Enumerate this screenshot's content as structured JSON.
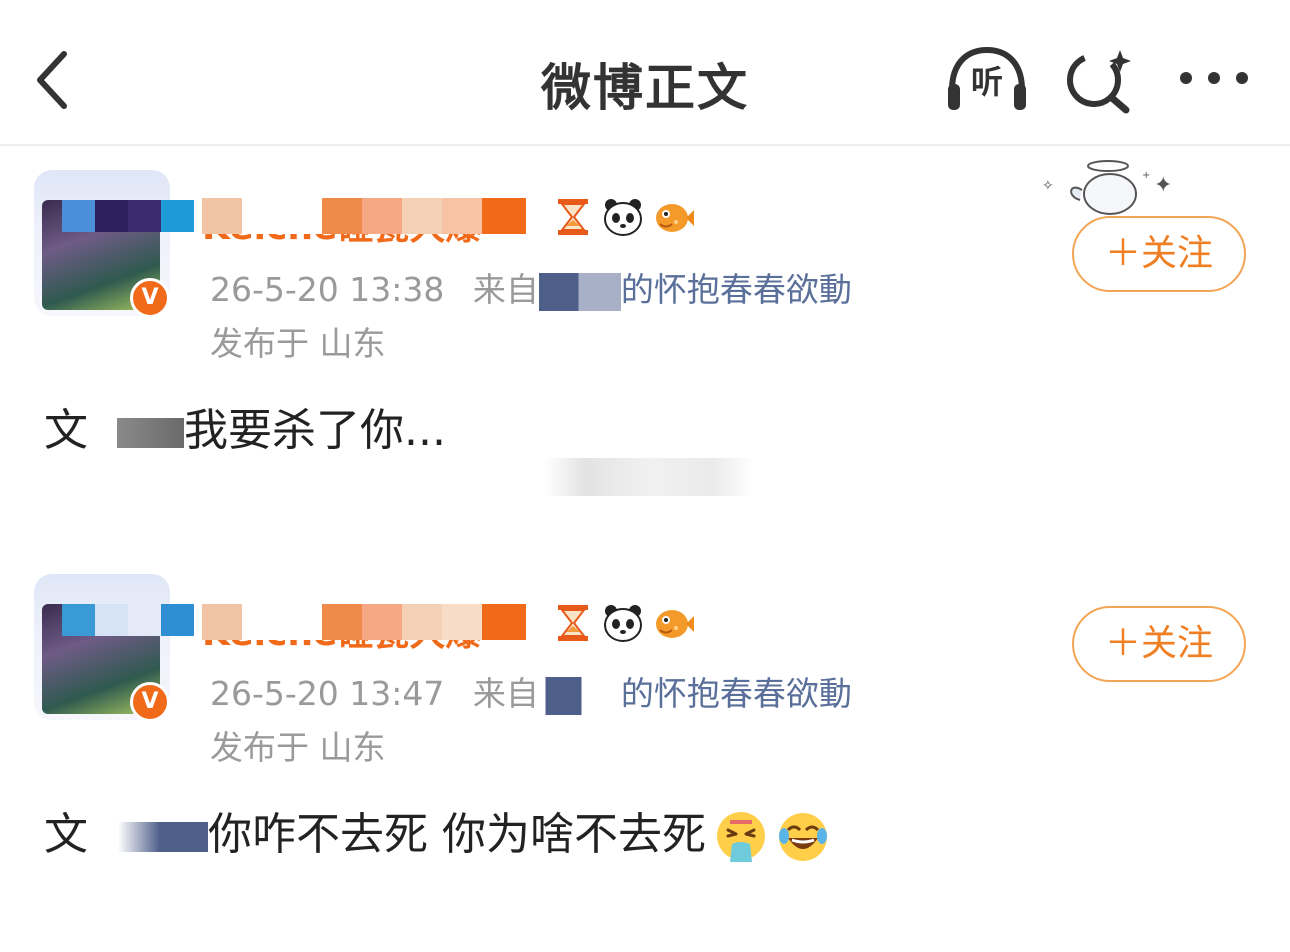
{
  "navbar": {
    "title": "微博正文",
    "listen_label": "听",
    "back_icon": "chevron-left-icon",
    "listen_icon": "headphones-icon",
    "search_icon": "search-sparkle-icon",
    "more_icon": "more-dots-icon"
  },
  "comments": [
    {
      "username": "Kelche碰瓷大爆",
      "timestamp": "26-5-20 13:38",
      "source_prefix": "来自",
      "source_suffix": "的怀抱春春欲動",
      "location_label": "发布于 山东",
      "follow_label": "＋关注",
      "text": "我要杀了你...",
      "text_prefix_visible": "文",
      "badges": [
        "hourglass-icon",
        "panda-icon",
        "pufferfish-icon"
      ]
    },
    {
      "username": "Kelche碰瓷大爆",
      "timestamp": "26-5-20 13:47",
      "source_prefix": "来自",
      "source_suffix": "的怀抱春春欲動",
      "location_label": "发布于 山东",
      "follow_label": "＋关注",
      "text": "你咋不去死 你为啥不去死",
      "text_prefix_visible": "文",
      "badges": [
        "hourglass-icon",
        "panda-icon",
        "pufferfish-icon"
      ],
      "emojis": [
        "vomit-emoji-icon",
        "laughing-tears-emoji-icon"
      ]
    }
  ],
  "colors": {
    "accent_orange": "#f06a1a",
    "follow_border": "#f3a455",
    "meta_gray": "#9a9a9a",
    "source_blue": "#5a6f99"
  }
}
